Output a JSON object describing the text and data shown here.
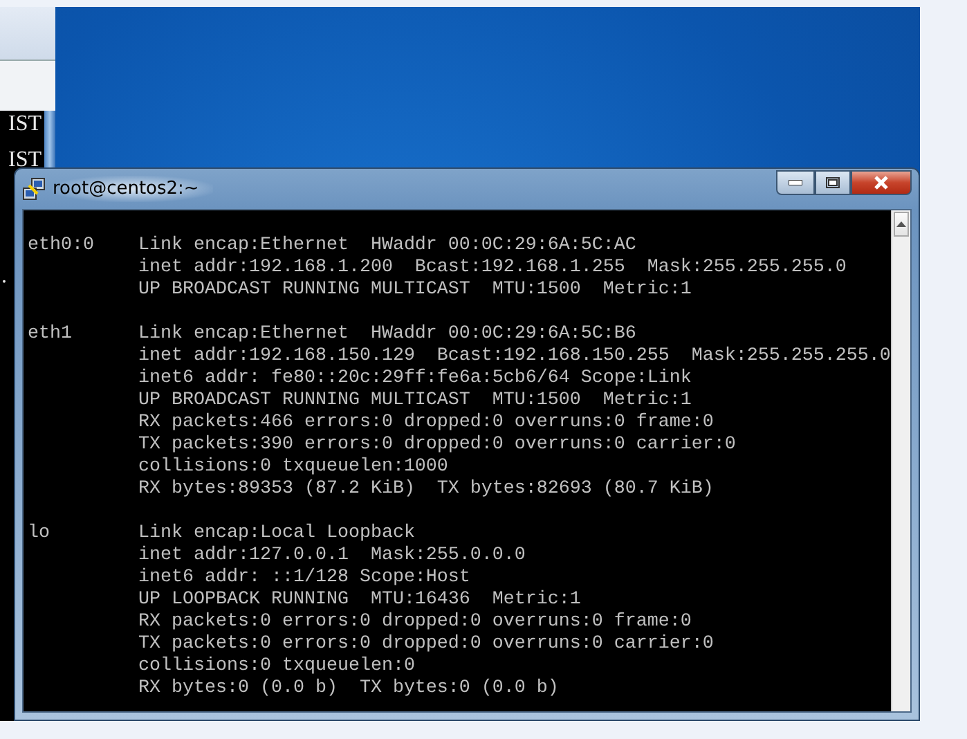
{
  "background_window": {
    "lines": [
      "IST",
      "IST",
      "."
    ]
  },
  "terminal": {
    "title": "root@centos2:~",
    "interfaces": [
      {
        "lines": [
          "eth0:0    Link encap:Ethernet  HWaddr 00:0C:29:6A:5C:AC",
          "          inet addr:192.168.1.200  Bcast:192.168.1.255  Mask:255.255.255.0",
          "          UP BROADCAST RUNNING MULTICAST  MTU:1500  Metric:1"
        ]
      },
      {
        "lines": [
          "eth1      Link encap:Ethernet  HWaddr 00:0C:29:6A:5C:B6",
          "          inet addr:192.168.150.129  Bcast:192.168.150.255  Mask:255.255.255.0",
          "          inet6 addr: fe80::20c:29ff:fe6a:5cb6/64 Scope:Link",
          "          UP BROADCAST RUNNING MULTICAST  MTU:1500  Metric:1",
          "          RX packets:466 errors:0 dropped:0 overruns:0 frame:0",
          "          TX packets:390 errors:0 dropped:0 overruns:0 carrier:0",
          "          collisions:0 txqueuelen:1000",
          "          RX bytes:89353 (87.2 KiB)  TX bytes:82693 (80.7 KiB)"
        ]
      },
      {
        "lines": [
          "lo        Link encap:Local Loopback",
          "          inet addr:127.0.0.1  Mask:255.0.0.0",
          "          inet6 addr: ::1/128 Scope:Host",
          "          UP LOOPBACK RUNNING  MTU:16436  Metric:1",
          "          RX packets:0 errors:0 dropped:0 overruns:0 frame:0",
          "          TX packets:0 errors:0 dropped:0 overruns:0 carrier:0",
          "          collisions:0 txqueuelen:0",
          "          RX bytes:0 (0.0 b)  TX bytes:0 (0.0 b)"
        ]
      }
    ]
  }
}
